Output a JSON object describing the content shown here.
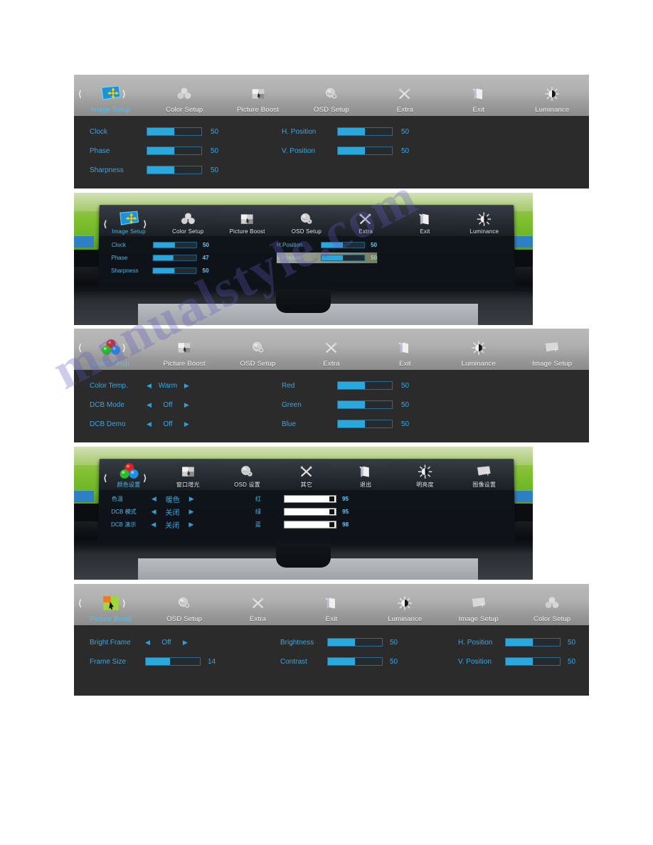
{
  "watermark": {
    "text": "manualstyle.com"
  },
  "panels": [
    {
      "id": "image-setup-menu",
      "type": "osd",
      "nav": [
        {
          "label": "Image Setup",
          "icon": "image-setup-icon",
          "active": true
        },
        {
          "label": "Color Setup",
          "icon": "color-setup-icon",
          "active": false
        },
        {
          "label": "Picture Boost",
          "icon": "picture-boost-icon",
          "active": false
        },
        {
          "label": "OSD Setup",
          "icon": "osd-setup-icon",
          "active": false
        },
        {
          "label": "Extra",
          "icon": "extra-icon",
          "active": false
        },
        {
          "label": "Exit",
          "icon": "exit-icon",
          "active": false
        },
        {
          "label": "Luminance",
          "icon": "luminance-icon",
          "active": false
        }
      ],
      "columns": [
        [
          {
            "label": "Clock",
            "kind": "slider",
            "value": "50",
            "percent": 50
          },
          {
            "label": "Phase",
            "kind": "slider",
            "value": "50",
            "percent": 50
          },
          {
            "label": "Sharpness",
            "kind": "slider",
            "value": "50",
            "percent": 50
          }
        ],
        [
          {
            "label": "H. Position",
            "kind": "slider",
            "value": "50",
            "percent": 50
          },
          {
            "label": "V. Position",
            "kind": "slider",
            "value": "50",
            "percent": 50
          }
        ]
      ]
    },
    {
      "id": "image-setup-photo",
      "type": "photo",
      "nav": [
        {
          "label": "Image Setup",
          "icon": "image-setup-icon",
          "active": true
        },
        {
          "label": "Color Setup",
          "icon": "color-setup-icon",
          "active": false
        },
        {
          "label": "Picture Boost",
          "icon": "picture-boost-icon",
          "active": false
        },
        {
          "label": "OSD Setup",
          "icon": "osd-setup-icon",
          "active": false
        },
        {
          "label": "Extra",
          "icon": "extra-icon",
          "active": false
        },
        {
          "label": "Exit",
          "icon": "exit-icon",
          "active": false
        },
        {
          "label": "Luminance",
          "icon": "luminance-icon",
          "active": false
        }
      ],
      "columns": [
        [
          {
            "label": "Clock",
            "kind": "slider",
            "value": "50",
            "percent": 50
          },
          {
            "label": "Phase",
            "kind": "slider",
            "value": "47",
            "percent": 47
          },
          {
            "label": "Sharpness",
            "kind": "slider",
            "value": "50",
            "percent": 50
          }
        ],
        [
          {
            "label": "H.Position",
            "kind": "slider",
            "value": "50",
            "percent": 50
          },
          {
            "label": "V.Position",
            "kind": "slider",
            "value": "50",
            "percent": 50,
            "highlight": true
          }
        ]
      ]
    },
    {
      "id": "color-setup-menu",
      "type": "osd",
      "nav": [
        {
          "label": "Color Setup",
          "icon": "color-setup-icon",
          "active": true
        },
        {
          "label": "Picture Boost",
          "icon": "picture-boost-icon",
          "active": false
        },
        {
          "label": "OSD Setup",
          "icon": "osd-setup-icon",
          "active": false
        },
        {
          "label": "Extra",
          "icon": "extra-icon",
          "active": false
        },
        {
          "label": "Exit",
          "icon": "exit-icon",
          "active": false
        },
        {
          "label": "Luminance",
          "icon": "luminance-icon",
          "active": false
        },
        {
          "label": "Image Setup",
          "icon": "image-setup-icon",
          "active": false
        }
      ],
      "columns": [
        [
          {
            "label": "Color Temp.",
            "kind": "select",
            "value": "Warm"
          },
          {
            "label": "DCB Mode",
            "kind": "select",
            "value": "Off"
          },
          {
            "label": "DCB Demo",
            "kind": "select",
            "value": "Off"
          }
        ],
        [
          {
            "label": "Red",
            "kind": "slider",
            "value": "50",
            "percent": 50
          },
          {
            "label": "Green",
            "kind": "slider",
            "value": "50",
            "percent": 50
          },
          {
            "label": "Blue",
            "kind": "slider",
            "value": "50",
            "percent": 50
          }
        ]
      ]
    },
    {
      "id": "color-setup-photo-chinese",
      "type": "photo",
      "nav": [
        {
          "label": "颜色设置",
          "icon": "color-setup-icon",
          "active": true
        },
        {
          "label": "窗口增光",
          "icon": "picture-boost-icon",
          "active": false
        },
        {
          "label": "OSD 设置",
          "icon": "osd-setup-icon",
          "active": false
        },
        {
          "label": "其它",
          "icon": "extra-icon",
          "active": false
        },
        {
          "label": "退出",
          "icon": "exit-icon",
          "active": false
        },
        {
          "label": "明亮度",
          "icon": "luminance-icon",
          "active": false
        },
        {
          "label": "图像设置",
          "icon": "image-setup-icon",
          "active": false
        }
      ],
      "columns": [
        [
          {
            "label": "色温",
            "kind": "select",
            "value": "暖色"
          },
          {
            "label": "DCB 模式",
            "kind": "select",
            "value": "关闭"
          },
          {
            "label": "DCB 演示",
            "kind": "select",
            "value": "关闭"
          }
        ],
        [
          {
            "label": "红",
            "kind": "whiteslider",
            "value": "95",
            "percent": 95
          },
          {
            "label": "绿",
            "kind": "whiteslider",
            "value": "95",
            "percent": 95
          },
          {
            "label": "蓝",
            "kind": "whiteslider",
            "value": "98",
            "percent": 98
          }
        ]
      ]
    },
    {
      "id": "picture-boost-menu",
      "type": "osd",
      "nav": [
        {
          "label": "Picture Boost",
          "icon": "picture-boost-active-icon",
          "active": true
        },
        {
          "label": "OSD Setup",
          "icon": "osd-setup-icon",
          "active": false
        },
        {
          "label": "Extra",
          "icon": "extra-icon",
          "active": false
        },
        {
          "label": "Exit",
          "icon": "exit-icon",
          "active": false
        },
        {
          "label": "Luminance",
          "icon": "luminance-icon",
          "active": false
        },
        {
          "label": "Image Setup",
          "icon": "image-setup-icon",
          "active": false
        },
        {
          "label": "Color Setup",
          "icon": "color-setup-icon",
          "active": false
        }
      ],
      "columns": [
        [
          {
            "label": "Bright Frame",
            "kind": "select",
            "value": "Off"
          },
          {
            "label": "Frame Size",
            "kind": "slider",
            "value": "14",
            "percent": 45
          }
        ],
        [
          {
            "label": "Brightness",
            "kind": "slider",
            "value": "50",
            "percent": 50
          },
          {
            "label": "Contrast",
            "kind": "slider",
            "value": "50",
            "percent": 50
          }
        ],
        [
          {
            "label": "H. Position",
            "kind": "slider",
            "value": "50",
            "percent": 50
          },
          {
            "label": "V. Position",
            "kind": "slider",
            "value": "50",
            "percent": 50
          }
        ]
      ]
    }
  ],
  "colors": {
    "osd_body": "#2b2b2b",
    "osd_nav_light": "#b9b9b9",
    "label_blue": "#3aa6e0",
    "slider_fill": "#29a8dd",
    "active_label": "#4ec3ef",
    "watermark": "#5c56be"
  }
}
